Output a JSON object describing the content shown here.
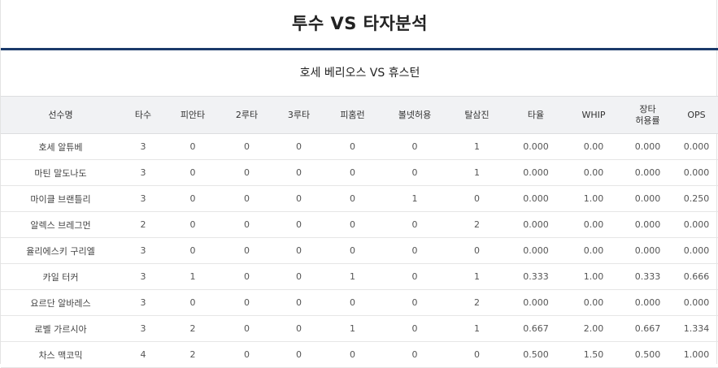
{
  "title": "투수 VS 타자분석",
  "matchup": "호세 베리오스 VS 휴스턴",
  "columns": [
    "선수명",
    "타수",
    "피안타",
    "2루타",
    "3루타",
    "피홈런",
    "볼넷허용",
    "탈삼진",
    "타율",
    "WHIP",
    "장타\n허용률",
    "OPS"
  ],
  "rows": [
    [
      "호세 알튜베",
      "3",
      "0",
      "0",
      "0",
      "0",
      "0",
      "1",
      "0.000",
      "0.00",
      "0.000",
      "0.000"
    ],
    [
      "마틴 말도나도",
      "3",
      "0",
      "0",
      "0",
      "0",
      "0",
      "1",
      "0.000",
      "0.00",
      "0.000",
      "0.000"
    ],
    [
      "마이클 브랜틀리",
      "3",
      "0",
      "0",
      "0",
      "0",
      "1",
      "0",
      "0.000",
      "1.00",
      "0.000",
      "0.250"
    ],
    [
      "알렉스 브레그먼",
      "2",
      "0",
      "0",
      "0",
      "0",
      "0",
      "2",
      "0.000",
      "0.00",
      "0.000",
      "0.000"
    ],
    [
      "율리에스키 구리엘",
      "3",
      "0",
      "0",
      "0",
      "0",
      "0",
      "0",
      "0.000",
      "0.00",
      "0.000",
      "0.000"
    ],
    [
      "카일 터커",
      "3",
      "1",
      "0",
      "0",
      "1",
      "0",
      "1",
      "0.333",
      "1.00",
      "0.333",
      "0.666"
    ],
    [
      "요르단 알바레스",
      "3",
      "0",
      "0",
      "0",
      "0",
      "0",
      "2",
      "0.000",
      "0.00",
      "0.000",
      "0.000"
    ],
    [
      "로벨 가르시아",
      "3",
      "2",
      "0",
      "0",
      "1",
      "0",
      "1",
      "0.667",
      "2.00",
      "0.667",
      "1.334"
    ],
    [
      "차스 맥코믹",
      "4",
      "2",
      "0",
      "0",
      "0",
      "0",
      "0",
      "0.500",
      "1.50",
      "0.500",
      "1.000"
    ]
  ]
}
